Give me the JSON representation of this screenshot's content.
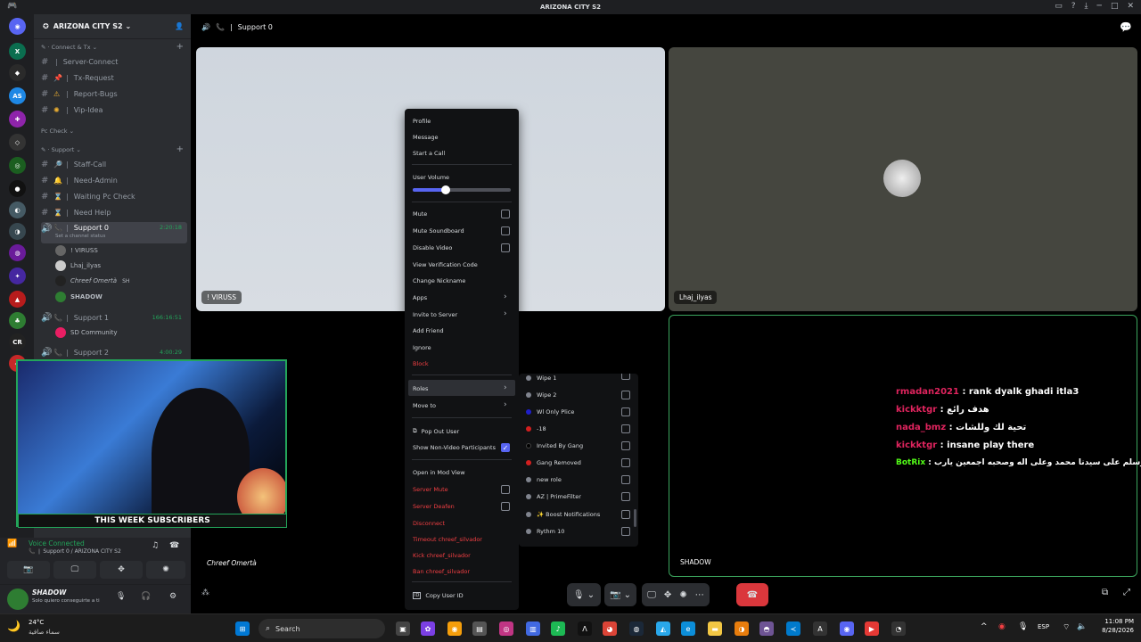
{
  "title_bar": {
    "title": "ARIZONA CITY S2"
  },
  "server": {
    "name": "ARIZONA CITY S2"
  },
  "sidebar": {
    "cat_connect": "Connect & Tx",
    "channels_top": [
      {
        "icon": "🌐",
        "name": "Server-Connect"
      },
      {
        "icon": "📌",
        "name": "Tx-Request"
      },
      {
        "icon": "⚠️",
        "name": "Report-Bugs"
      },
      {
        "icon": "🌟",
        "name": "Vip-Idea"
      }
    ],
    "cat_pccheck": "Pc Check",
    "cat_support": "Support",
    "channels_support": [
      {
        "icon": "🔎",
        "name": "Staff-Call"
      },
      {
        "icon": "🔔",
        "name": "Need-Admin"
      },
      {
        "icon": "⌛",
        "name": "Waiting Pc Check"
      },
      {
        "icon": "⌛",
        "name": "Need Help"
      }
    ],
    "voice0": {
      "name": "Support 0",
      "time": "2:20:18",
      "status": "Set a channel status"
    },
    "members": [
      "! VIRUSS",
      "Lhaj_ilyas",
      "Chreef Omertà",
      "SHADOW"
    ],
    "member_tag": "SH",
    "voice1": {
      "name": "Support 1",
      "time": "166:16:51"
    },
    "voice1_member": "SD Community",
    "voice2": {
      "name": "Support 2",
      "time": "4:00:29"
    },
    "pc_check_small": "Pc check"
  },
  "voice_panel": {
    "status": "Voice Connected",
    "location": "Support 0 / ARIZONA CITY S2"
  },
  "user": {
    "name": "SHADOW",
    "status": "Solo quiero conseguirte a ti"
  },
  "call": {
    "channel": "Support 0"
  },
  "tiles": {
    "viruss": "! VIRUSS",
    "lhaj": "Lhaj_ilyas",
    "chreef": "Chreef Omertà",
    "shadow": "SHADOW"
  },
  "webcam": {
    "banner": "THIS WEEK SUBSCRIBERS"
  },
  "context_menu": {
    "profile": "Profile",
    "message": "Message",
    "start_call": "Start a Call",
    "user_volume": "User Volume",
    "volume_pct": 0.34,
    "mute": "Mute",
    "mute_soundboard": "Mute Soundboard",
    "disable_video": "Disable Video",
    "view_verification": "View Verification Code",
    "change_nickname": "Change Nickname",
    "apps": "Apps",
    "invite": "Invite to Server",
    "add_friend": "Add Friend",
    "ignore": "Ignore",
    "block": "Block",
    "roles": "Roles",
    "move_to": "Move to",
    "pop_out": "Pop Out User",
    "show_non_video": "Show Non-Video Participants",
    "open_mod": "Open in Mod View",
    "server_mute": "Server Mute",
    "server_deafen": "Server Deafen",
    "disconnect": "Disconnect",
    "timeout": "Timeout chreef_silvador",
    "kick": "Kick chreef_silvador",
    "ban": "Ban chreef_silvador",
    "copy_id": "Copy User ID"
  },
  "roles_menu": [
    {
      "name": "Wipe 1",
      "color": "#80848e"
    },
    {
      "name": "Wipe 2",
      "color": "#80848e"
    },
    {
      "name": "Wl Only Plice",
      "color": "#1f1fc9"
    },
    {
      "name": "-18",
      "color": "#d21f1f"
    },
    {
      "name": "Invited By Gang",
      "color": "#000000"
    },
    {
      "name": "Gang Removed",
      "color": "#d21f1f"
    },
    {
      "name": "new role",
      "color": "#80848e"
    },
    {
      "name": "AZ | PrimeFilter",
      "color": "#80848e"
    },
    {
      "name": "✨ Boost Notifications",
      "color": "#80848e"
    },
    {
      "name": "Rythm 10",
      "color": "#80848e"
    }
  ],
  "chat": [
    {
      "user": "rmadan2021",
      "user_color": "#e0245e",
      "text": " : rank dyalk ghadi itla3"
    },
    {
      "user": "kickktgr",
      "user_color": "#e0245e",
      "text": " : هدف رائع"
    },
    {
      "user": "nada_bmz",
      "user_color": "#e0245e",
      "text": " : تحية لك وللشات"
    },
    {
      "user": "kickktgr",
      "user_color": "#e0245e",
      "text": " : insane play there"
    },
    {
      "user": "BotRix",
      "user_color": "#53fc18",
      "text": " : اللهم صلي وسلم على سيدنا محمد وعلى اله وصحبه اجمعين يارب"
    }
  ],
  "taskbar": {
    "weather_temp": "24°C",
    "weather_desc": "سماء صافية",
    "search": "Search",
    "lang": "ESP",
    "time": "11:08 PM",
    "date": "8/28/2026"
  },
  "colors": {
    "accent": "#5865f2",
    "green": "#23a55a",
    "red": "#f23f43",
    "hangup": "#da373c"
  }
}
